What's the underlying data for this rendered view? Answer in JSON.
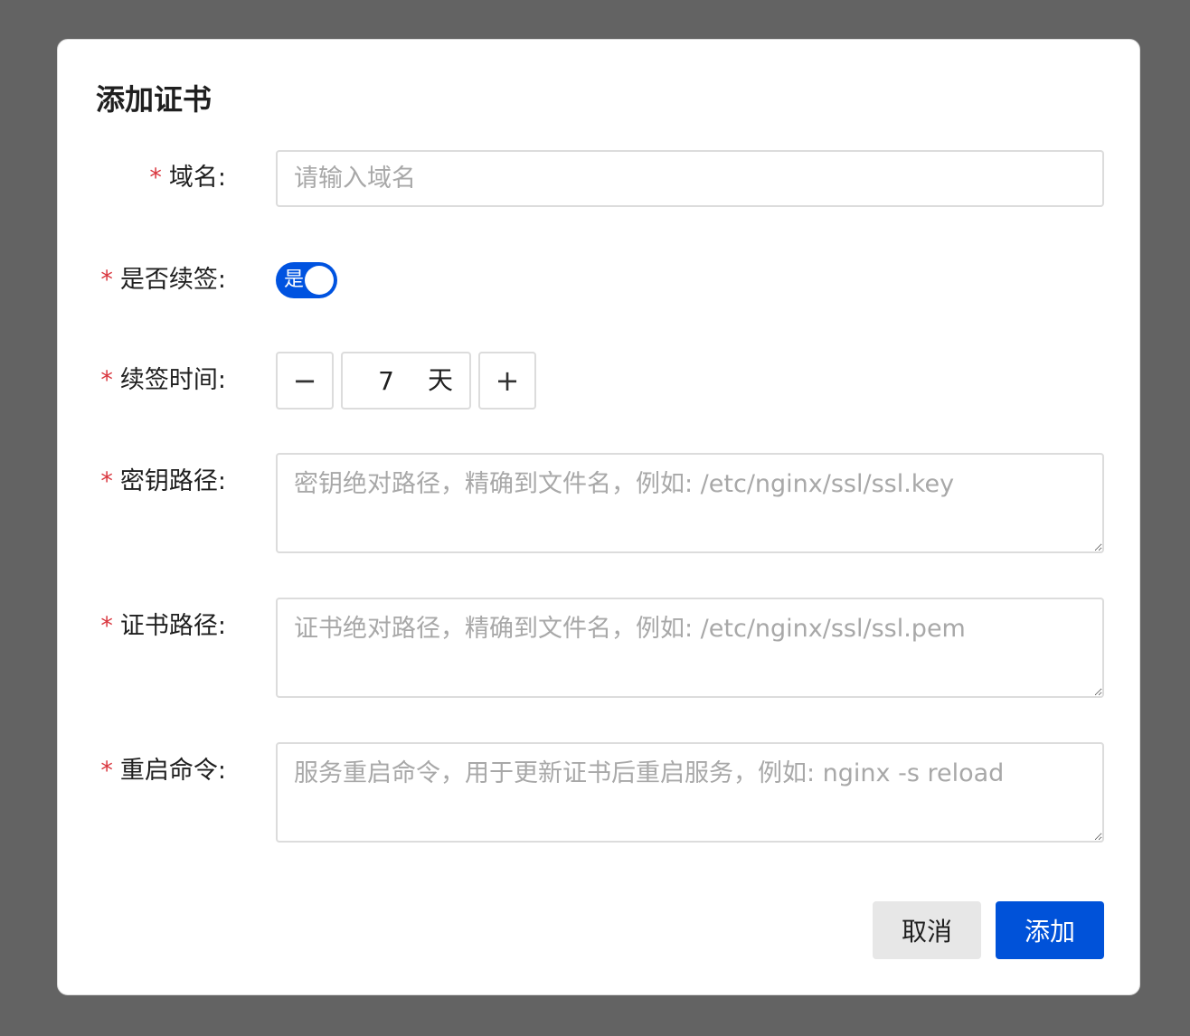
{
  "dialog": {
    "title": "添加证书"
  },
  "form": {
    "domain": {
      "required_mark": "*",
      "label": "域名:",
      "placeholder": "请输入域名",
      "value": ""
    },
    "auto_renew": {
      "required_mark": "*",
      "label": "是否续签:",
      "toggle_text": "是",
      "checked": true
    },
    "renew_days": {
      "required_mark": "*",
      "label": "续签时间:",
      "value": "7",
      "unit": "天",
      "minus_symbol": "−",
      "plus_symbol": "+"
    },
    "key_path": {
      "required_mark": "*",
      "label": "密钥路径:",
      "placeholder": "密钥绝对路径，精确到文件名，例如: /etc/nginx/ssl/ssl.key"
    },
    "cert_path": {
      "required_mark": "*",
      "label": "证书路径:",
      "placeholder": "证书绝对路径，精确到文件名，例如: /etc/nginx/ssl/ssl.pem"
    },
    "restart_cmd": {
      "required_mark": "*",
      "label": "重启命令:",
      "placeholder": "服务重启命令，用于更新证书后重启服务，例如: nginx -s reload"
    }
  },
  "footer": {
    "cancel_label": "取消",
    "submit_label": "添加"
  },
  "colors": {
    "primary": "#0052d9",
    "required": "#d9363e",
    "overlay": "#636363"
  }
}
